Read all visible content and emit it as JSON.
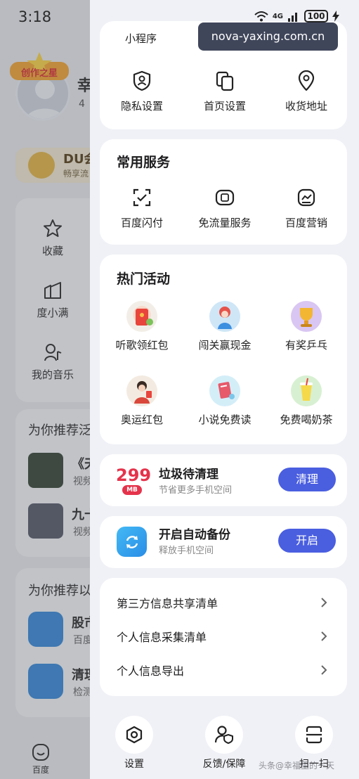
{
  "status_bar": {
    "time": "3:18",
    "network": "4G",
    "battery": "100"
  },
  "watermark": {
    "site": "nova-yaxing.com.cn",
    "bottom_text": "头条@幸福里的一天"
  },
  "background_page": {
    "user_name_partial": "幸",
    "user_sub_partial": "4",
    "badge_text": "创作之星",
    "vip_title_partial": "DU会",
    "vip_sub_partial": "畅享流",
    "left_menu": [
      {
        "label": "收藏",
        "icon": "star-icon"
      },
      {
        "label": "度小满",
        "icon": "wallet-icon"
      },
      {
        "label": "我的音乐",
        "icon": "music-icon"
      }
    ],
    "recommend_1": {
      "title": "为你推荐泛",
      "items": [
        {
          "title": "《天",
          "sub": "视频"
        },
        {
          "title": "九十",
          "sub": "视频"
        }
      ]
    },
    "recommend_2": {
      "title": "为你推荐以",
      "items": [
        {
          "title": "股市",
          "sub": "百度",
          "icon": "chart-icon"
        },
        {
          "title": "清理",
          "sub": "检测",
          "icon": "trash-icon"
        }
      ]
    },
    "home_tab": "百度"
  },
  "panel": {
    "top_partial_label": "小程序",
    "settings_row": [
      {
        "label": "隐私设置",
        "icon": "privacy-shield-icon"
      },
      {
        "label": "首页设置",
        "icon": "home-settings-icon"
      },
      {
        "label": "收货地址",
        "icon": "location-pin-icon"
      }
    ],
    "common_services": {
      "title": "常用服务",
      "items": [
        {
          "label": "百度闪付",
          "icon": "scan-pay-icon"
        },
        {
          "label": "免流量服务",
          "icon": "free-data-icon"
        },
        {
          "label": "百度营销",
          "icon": "marketing-chart-icon"
        }
      ]
    },
    "hot_activities": {
      "title": "热门活动",
      "items": [
        {
          "label": "听歌领红包",
          "icon": "red-envelope-icon",
          "color": "#e8453c"
        },
        {
          "label": "闯关赢现金",
          "icon": "game-character-icon",
          "color": "#4aa3e8"
        },
        {
          "label": "有奖乒乓",
          "icon": "trophy-icon",
          "color": "#f2b632"
        },
        {
          "label": "奥运红包",
          "icon": "olympic-character-icon",
          "color": "#d9483b"
        },
        {
          "label": "小说免费读",
          "icon": "book-icon",
          "color": "#7cc6ea"
        },
        {
          "label": "免费喝奶茶",
          "icon": "milk-tea-icon",
          "color": "#f5d94a"
        }
      ]
    },
    "cleanup": {
      "amount": "299",
      "unit": "MB",
      "title": "垃圾待清理",
      "sub": "节省更多手机空间",
      "button": "清理"
    },
    "backup": {
      "title": "开启自动备份",
      "sub": "释放手机空间",
      "button": "开启",
      "icon": "sync-icon"
    },
    "info_list": [
      {
        "label": "第三方信息共享清单"
      },
      {
        "label": "个人信息采集清单"
      },
      {
        "label": "个人信息导出"
      }
    ],
    "bottom_bar": [
      {
        "label": "设置",
        "icon": "settings-hex-icon"
      },
      {
        "label": "反馈/保障",
        "icon": "feedback-user-shield-icon"
      },
      {
        "label": "扫一扫",
        "icon": "scan-icon"
      }
    ]
  },
  "colors": {
    "accent": "#4a5ee0",
    "danger": "#e5334b",
    "panel_bg": "#f0f1f6"
  }
}
